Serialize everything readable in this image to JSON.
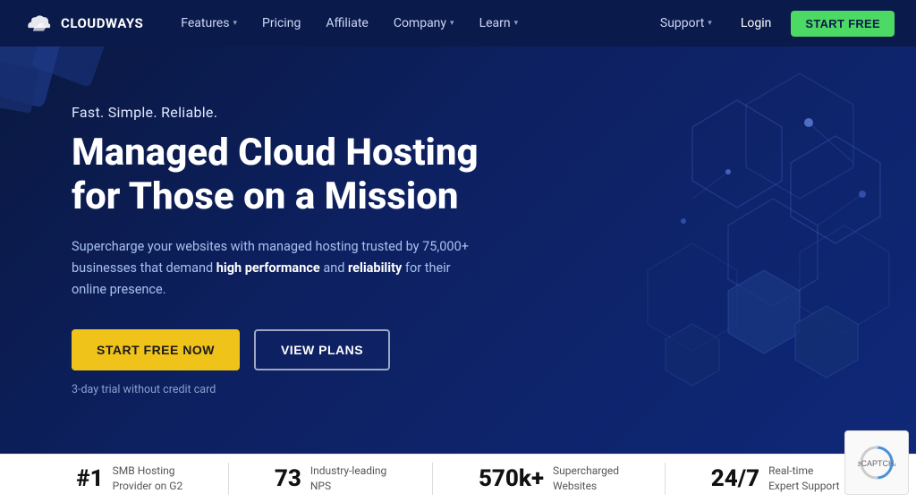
{
  "navbar": {
    "logo_text": "CLOUDWAYS",
    "nav_items": [
      {
        "label": "Features",
        "has_dropdown": true
      },
      {
        "label": "Pricing",
        "has_dropdown": false
      },
      {
        "label": "Affiliate",
        "has_dropdown": false
      },
      {
        "label": "Company",
        "has_dropdown": true
      },
      {
        "label": "Learn",
        "has_dropdown": true
      }
    ],
    "support_label": "Support",
    "login_label": "Login",
    "cta_label": "START FREE"
  },
  "hero": {
    "tagline": "Fast. Simple. Reliable.",
    "title_line1": "Managed Cloud Hosting",
    "title_line2": "for Those on a Mission",
    "description_before": "Supercharge your websites with managed hosting trusted by 75,000+ businesses that demand ",
    "description_bold1": "high performance",
    "description_middle": " and ",
    "description_bold2": "reliability",
    "description_after": " for their online presence.",
    "btn_primary": "START FREE NOW",
    "btn_secondary": "VIEW PLANS",
    "note": "3-day trial without credit card"
  },
  "stats": [
    {
      "number": "#1",
      "label": "SMB Hosting\nProvider on G2"
    },
    {
      "number": "73",
      "label": "Industry-leading\nNPS"
    },
    {
      "number": "570k+",
      "label": "Supercharged\nWebsites"
    },
    {
      "number": "24/7",
      "label": "Real-time\nExpert Support"
    }
  ],
  "colors": {
    "nav_bg": "#0a1a4a",
    "hero_bg": "#0d1f5c",
    "cta_green": "#4cd964",
    "btn_yellow": "#f0c31a",
    "stats_bg": "#ffffff"
  }
}
